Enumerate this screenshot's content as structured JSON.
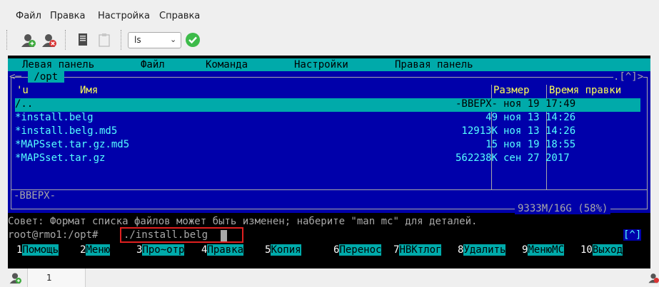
{
  "menu": {
    "file": "Файл",
    "edit": "Правка",
    "settings": "Настройка",
    "help": "Справка"
  },
  "toolbar": {
    "command_combo_value": "ls"
  },
  "mc": {
    "topmenu": [
      "Левая панель",
      "Файл",
      "Команда",
      "Настройки",
      "Правая панель"
    ],
    "path": " /opt ",
    "corner": ".[^]>",
    "headers": {
      "sort": "'u",
      "name": "Имя",
      "size": "Размер",
      "mtime": "Время правки"
    },
    "rows": [
      {
        "name": "/..",
        "size": "-BBEPX-",
        "date": "ноя 19 17:49",
        "selected": true
      },
      {
        "name": "*install.belg",
        "size": "49",
        "date": "ноя 13 14:26"
      },
      {
        "name": "*install.belg.md5",
        "size": "12913K",
        "date": "ноя 13 14:26"
      },
      {
        "name": "*MAPSset.tar.gz.md5",
        "size": "15",
        "date": "ноя 19 18:55"
      },
      {
        "name": "*MAPSset.tar.gz",
        "size": "562238K",
        "date": "сен 27  2017"
      }
    ],
    "status_selected": "-BBEPX-",
    "disk_info": "9333M/16G (58%)",
    "hint": "Совет: Формат списка файлов может быть изменен; наберите \"man mc\" для деталей.",
    "prompt": "root@rmo1:/opt# ",
    "command": "./install.belg",
    "cmd_corner": "[^]",
    "fkeys": [
      {
        "num": "1",
        "label": "Помощь"
      },
      {
        "num": "2",
        "label": "Меню"
      },
      {
        "num": "3",
        "label": "Про~отр"
      },
      {
        "num": "4",
        "label": "Правка"
      },
      {
        "num": "5",
        "label": "Копия"
      },
      {
        "num": "6",
        "label": "Перенос"
      },
      {
        "num": "7",
        "label": "НВКтлог"
      },
      {
        "num": "8",
        "label": "Удалить"
      },
      {
        "num": "9",
        "label": "МенюМС"
      },
      {
        "num": "10",
        "label": "Выход"
      }
    ]
  },
  "tabs": {
    "tab1": "1"
  },
  "colors": {
    "panel_bg": "#0000aa",
    "cyan": "#00aaaa",
    "text_cyan": "#55ffff",
    "highlight": "#e02020"
  }
}
